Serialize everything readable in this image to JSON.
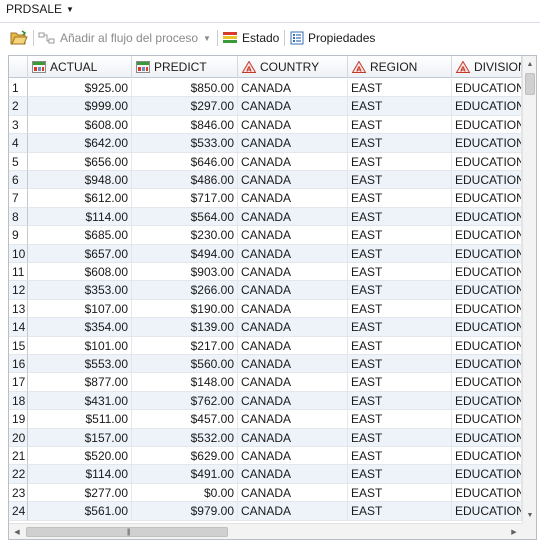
{
  "header": {
    "title": "PRDSALE",
    "dropdown_icon": "chevron-down-icon"
  },
  "toolbar": {
    "add_to_flow_label": "Añadir al flujo del proceso",
    "status_label": "Estado",
    "properties_label": "Propiedades"
  },
  "table": {
    "columns": [
      {
        "label": "ACTUAL",
        "type": "numeric",
        "icon": "numeric-column-icon"
      },
      {
        "label": "PREDICT",
        "type": "numeric",
        "icon": "numeric-column-icon"
      },
      {
        "label": "COUNTRY",
        "type": "character",
        "icon": "character-column-icon"
      },
      {
        "label": "REGION",
        "type": "character",
        "icon": "character-column-icon"
      },
      {
        "label": "DIVISION",
        "type": "character",
        "icon": "character-column-icon"
      }
    ],
    "rows": [
      {
        "n": "1",
        "actual": "$925.00",
        "predict": "$850.00",
        "country": "CANADA",
        "region": "EAST",
        "division": "EDUCATION"
      },
      {
        "n": "2",
        "actual": "$999.00",
        "predict": "$297.00",
        "country": "CANADA",
        "region": "EAST",
        "division": "EDUCATION"
      },
      {
        "n": "3",
        "actual": "$608.00",
        "predict": "$846.00",
        "country": "CANADA",
        "region": "EAST",
        "division": "EDUCATION"
      },
      {
        "n": "4",
        "actual": "$642.00",
        "predict": "$533.00",
        "country": "CANADA",
        "region": "EAST",
        "division": "EDUCATION"
      },
      {
        "n": "5",
        "actual": "$656.00",
        "predict": "$646.00",
        "country": "CANADA",
        "region": "EAST",
        "division": "EDUCATION"
      },
      {
        "n": "6",
        "actual": "$948.00",
        "predict": "$486.00",
        "country": "CANADA",
        "region": "EAST",
        "division": "EDUCATION"
      },
      {
        "n": "7",
        "actual": "$612.00",
        "predict": "$717.00",
        "country": "CANADA",
        "region": "EAST",
        "division": "EDUCATION"
      },
      {
        "n": "8",
        "actual": "$114.00",
        "predict": "$564.00",
        "country": "CANADA",
        "region": "EAST",
        "division": "EDUCATION"
      },
      {
        "n": "9",
        "actual": "$685.00",
        "predict": "$230.00",
        "country": "CANADA",
        "region": "EAST",
        "division": "EDUCATION"
      },
      {
        "n": "10",
        "actual": "$657.00",
        "predict": "$494.00",
        "country": "CANADA",
        "region": "EAST",
        "division": "EDUCATION"
      },
      {
        "n": "11",
        "actual": "$608.00",
        "predict": "$903.00",
        "country": "CANADA",
        "region": "EAST",
        "division": "EDUCATION"
      },
      {
        "n": "12",
        "actual": "$353.00",
        "predict": "$266.00",
        "country": "CANADA",
        "region": "EAST",
        "division": "EDUCATION"
      },
      {
        "n": "13",
        "actual": "$107.00",
        "predict": "$190.00",
        "country": "CANADA",
        "region": "EAST",
        "division": "EDUCATION"
      },
      {
        "n": "14",
        "actual": "$354.00",
        "predict": "$139.00",
        "country": "CANADA",
        "region": "EAST",
        "division": "EDUCATION"
      },
      {
        "n": "15",
        "actual": "$101.00",
        "predict": "$217.00",
        "country": "CANADA",
        "region": "EAST",
        "division": "EDUCATION"
      },
      {
        "n": "16",
        "actual": "$553.00",
        "predict": "$560.00",
        "country": "CANADA",
        "region": "EAST",
        "division": "EDUCATION"
      },
      {
        "n": "17",
        "actual": "$877.00",
        "predict": "$148.00",
        "country": "CANADA",
        "region": "EAST",
        "division": "EDUCATION"
      },
      {
        "n": "18",
        "actual": "$431.00",
        "predict": "$762.00",
        "country": "CANADA",
        "region": "EAST",
        "division": "EDUCATION"
      },
      {
        "n": "19",
        "actual": "$511.00",
        "predict": "$457.00",
        "country": "CANADA",
        "region": "EAST",
        "division": "EDUCATION"
      },
      {
        "n": "20",
        "actual": "$157.00",
        "predict": "$532.00",
        "country": "CANADA",
        "region": "EAST",
        "division": "EDUCATION"
      },
      {
        "n": "21",
        "actual": "$520.00",
        "predict": "$629.00",
        "country": "CANADA",
        "region": "EAST",
        "division": "EDUCATION"
      },
      {
        "n": "22",
        "actual": "$114.00",
        "predict": "$491.00",
        "country": "CANADA",
        "region": "EAST",
        "division": "EDUCATION"
      },
      {
        "n": "23",
        "actual": "$277.00",
        "predict": "$0.00",
        "country": "CANADA",
        "region": "EAST",
        "division": "EDUCATION"
      },
      {
        "n": "24",
        "actual": "$561.00",
        "predict": "$979.00",
        "country": "CANADA",
        "region": "EAST",
        "division": "EDUCATION"
      }
    ]
  },
  "colors": {
    "alt_row": "#eef3fa",
    "grid_line": "#e3e7ec"
  }
}
